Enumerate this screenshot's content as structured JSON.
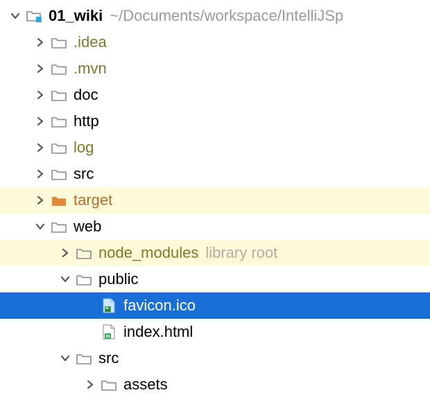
{
  "root": {
    "name": "01_wiki",
    "path": "~/Documents/workspace/IntelliJSp"
  },
  "nodes": {
    "idea": {
      "label": ".idea"
    },
    "mvn": {
      "label": ".mvn"
    },
    "doc": {
      "label": "doc"
    },
    "http": {
      "label": "http"
    },
    "log": {
      "label": "log"
    },
    "src": {
      "label": "src"
    },
    "target": {
      "label": "target"
    },
    "web": {
      "label": "web"
    },
    "node_modules": {
      "label": "node_modules",
      "suffix": "library root"
    },
    "public": {
      "label": "public"
    },
    "favicon": {
      "label": "favicon.ico"
    },
    "indexhtml": {
      "label": "index.html"
    },
    "websrc": {
      "label": "src"
    },
    "assets": {
      "label": "assets"
    }
  }
}
